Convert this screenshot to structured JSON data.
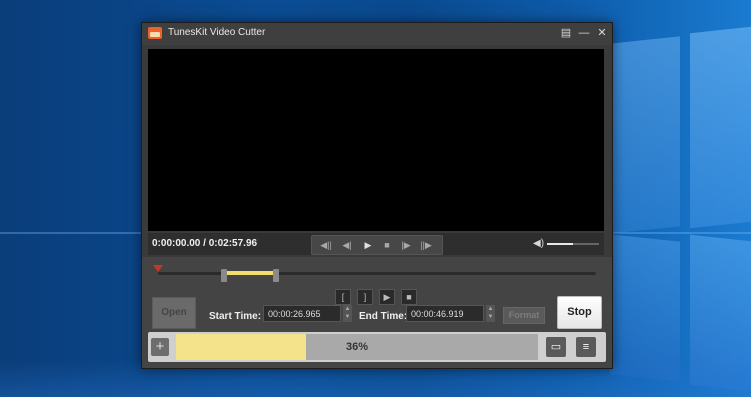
{
  "window": {
    "title": "TunesKit Video Cutter",
    "menu_icon": "menu-icon",
    "minimize_icon": "minimize-icon",
    "close_icon": "close-icon"
  },
  "player": {
    "timecode": "0:00:00.00 / 0:02:57.96",
    "controls": [
      "prev-frame-icon",
      "step-back-icon",
      "play-icon",
      "stop-icon",
      "step-forward-icon",
      "next-frame-icon"
    ],
    "volume_level": 0.5
  },
  "editor": {
    "segment_buttons": [
      "mark-in-icon",
      "mark-out-icon",
      "preview-segment-icon",
      "stop-segment-icon"
    ],
    "open_label": "Open",
    "start_time_label": "Start Time:",
    "start_time_value": "00:00:26.965",
    "end_time_label": "End Time:",
    "end_time_value": "00:00:46.919",
    "format_label": "Format",
    "stop_label": "Stop"
  },
  "progress": {
    "percent_text": "36%",
    "fraction": 0.36
  },
  "colors": {
    "accent_yellow": "#f4e38a",
    "marker_red": "#c7362a"
  }
}
